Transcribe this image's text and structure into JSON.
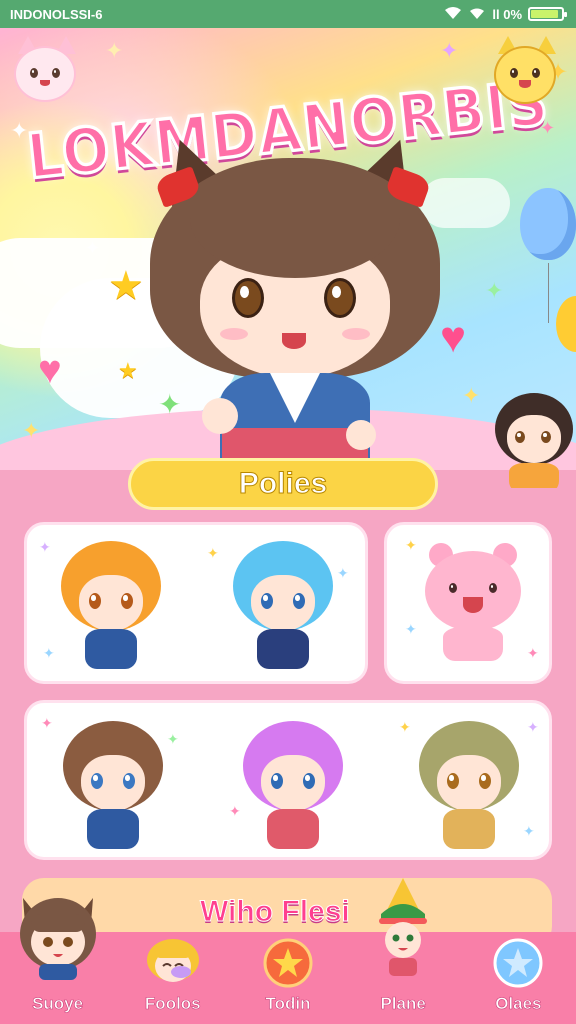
{
  "status_bar": {
    "carrier": "INDONOLSSI-6",
    "signal_text": "ll 0%",
    "battery_level": 0.9
  },
  "hero": {
    "title": "LOKMDANORBIS"
  },
  "section": {
    "title": "Polies"
  },
  "banner": {
    "title": "Wiho Flesi"
  },
  "bottom_nav": {
    "items": [
      {
        "label": "Suoye",
        "icon": "cat-girl-avatar-icon"
      },
      {
        "label": "Foolos",
        "icon": "blonde-avatar-icon"
      },
      {
        "label": "Todin",
        "icon": "star-badge-icon"
      },
      {
        "label": "Plane",
        "icon": "elf-avatar-icon"
      },
      {
        "label": "Olaes",
        "icon": "star-bubble-icon"
      }
    ]
  },
  "colors": {
    "status_bar": "#55a970",
    "accent_pink": "#f97fa8",
    "pill_yellow": "#fbd445",
    "banner_peach": "#ffd9a8"
  }
}
